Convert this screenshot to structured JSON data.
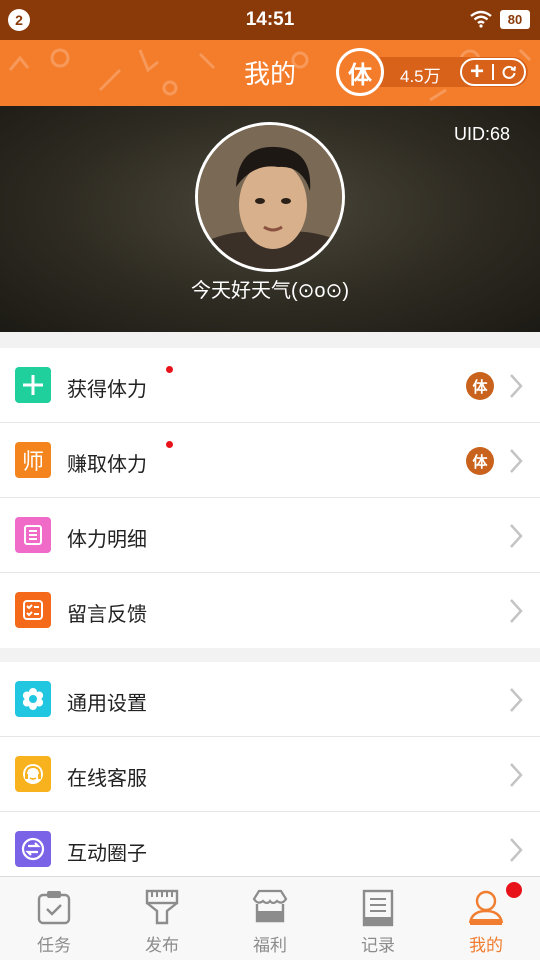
{
  "status_bar": {
    "notification_count": "2",
    "time": "14:51",
    "battery": "80",
    "wifi_icon": "wifi-icon"
  },
  "header": {
    "title": "我的",
    "energy_icon_char": "体",
    "energy_value": "4.5万",
    "add_icon": "plus-icon",
    "refresh_icon": "refresh-icon"
  },
  "profile": {
    "uid": "UID:68",
    "nickname": "今天好天气(⊙o⊙)"
  },
  "menu_group_1": {
    "items": [
      {
        "label": "获得体力",
        "icon": "plus-icon",
        "icon_color": "#1fcf9c",
        "has_dot": true,
        "badge": "体"
      },
      {
        "label": "赚取体力",
        "icon": "teacher-icon",
        "icon_char": "师",
        "icon_color": "#f4841e",
        "has_dot": true,
        "badge": "体"
      },
      {
        "label": "体力明细",
        "icon": "list-icon",
        "icon_color": "#f06ac8",
        "has_dot": false
      },
      {
        "label": "留言反馈",
        "icon": "checklist-icon",
        "icon_color": "#f46a1a",
        "has_dot": false
      }
    ]
  },
  "menu_group_2": {
    "items": [
      {
        "label": "通用设置",
        "icon": "gear-icon",
        "icon_color": "#21c6e0"
      },
      {
        "label": "在线客服",
        "icon": "headset-icon",
        "icon_color": "#f8b21e"
      },
      {
        "label": "互动圈子",
        "icon": "exchange-icon",
        "icon_color": "#7b63e8"
      }
    ]
  },
  "tab_bar": {
    "tabs": [
      {
        "label": "任务",
        "icon": "task-clipboard-icon",
        "active": false
      },
      {
        "label": "发布",
        "icon": "brush-icon",
        "active": false
      },
      {
        "label": "福利",
        "icon": "shop-icon",
        "active": false
      },
      {
        "label": "记录",
        "icon": "record-icon",
        "active": false
      },
      {
        "label": "我的",
        "icon": "person-icon",
        "active": true
      }
    ]
  },
  "colors": {
    "accent": "#f47d2c",
    "status_bar": "#8a3a08",
    "notification_dot": "#e8121a",
    "active_tab": "#f07d30"
  }
}
